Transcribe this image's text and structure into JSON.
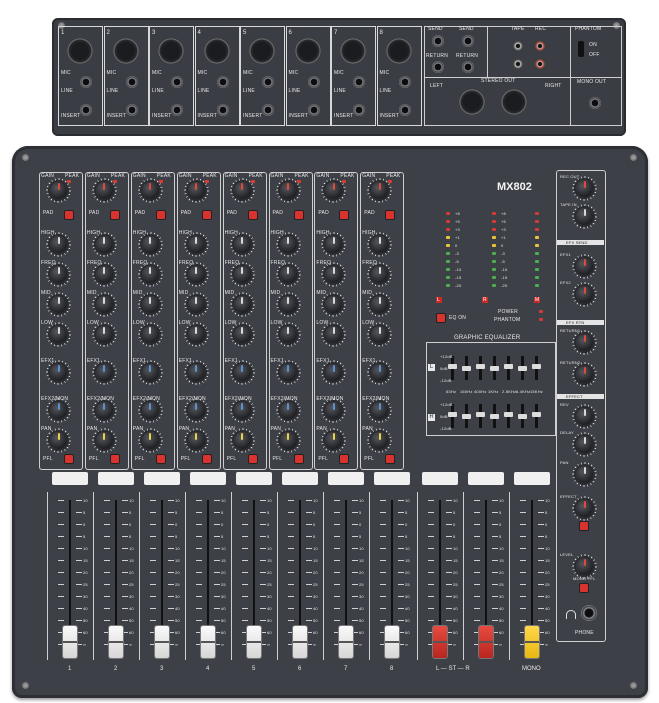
{
  "top_panel": {
    "channels": [
      "1",
      "2",
      "3",
      "4",
      "5",
      "6",
      "7",
      "8"
    ],
    "mic_label": "MIC",
    "line_label": "LINE",
    "insert_label": "INSERT",
    "send_labels": [
      "SEND",
      "SEND"
    ],
    "return_labels": [
      "RETURN",
      "RETURN"
    ],
    "tape_label": "TAPE",
    "rec_label": "REC",
    "phantom_label": "PHANTOM",
    "phantom_on": "ON",
    "phantom_off": "OFF",
    "stereo_out_label": "STEREO OUT",
    "left_label": "LEFT",
    "right_label": "RIGHT",
    "mono_out_label": "MONO OUT"
  },
  "mixer": {
    "model": "MX802",
    "knob_labels": [
      "GAIN",
      "HIGH",
      "FREQ",
      "MID",
      "LOW",
      "EFX1",
      "EFX2/MON",
      "PAN"
    ],
    "peak_label": "PEAK",
    "pad_label": "PAD",
    "pfl_label": "PFL",
    "scale": [
      "+dB",
      "10",
      "5",
      "0",
      "5",
      "10",
      "15",
      "20",
      "25",
      "30",
      "40",
      "50",
      "60",
      "∞"
    ],
    "fader_labels": [
      "1",
      "2",
      "3",
      "4",
      "5",
      "6",
      "7",
      "8",
      "L — ST — R",
      "MONO"
    ],
    "meter_labels": [
      "+8",
      "+5",
      "+3",
      "+1",
      "0",
      "-3",
      "-5",
      "-10",
      "-15",
      "-20"
    ],
    "meter_channels": [
      "L",
      "R",
      "M"
    ],
    "power_label": "POWER",
    "phantom_label": "PHANTOM",
    "graphic_eq_label": "GRAPHIC EQUALIZER",
    "eq_bands": [
      "63Hz",
      "160Hz",
      "400Hz",
      "1KHz",
      "2.5KHz",
      "6.4KHz",
      "15KHz"
    ],
    "eq_channels": [
      "L",
      "R"
    ],
    "eq_gain_top": "+12dB",
    "eq_gain_mid": "0dB",
    "eq_gain_bot": "-12dB",
    "right_section": {
      "rec_out": "REC OUT",
      "tape_in": "TAPE IN",
      "efx_send": "EFX SEND",
      "efx1": "EFX1",
      "efx2": "EFX2",
      "efx_rtn": "EFX RTN",
      "return1": "RETURN1",
      "return2": "RETURN2",
      "effect": "EFFECT",
      "rev": "REV",
      "delay": "DELAY",
      "pan": "PAN",
      "effect_knob": "EFFECT",
      "level": "LEVEL",
      "mono_pfl": "MONO PFL",
      "phones": "PHONE"
    }
  }
}
